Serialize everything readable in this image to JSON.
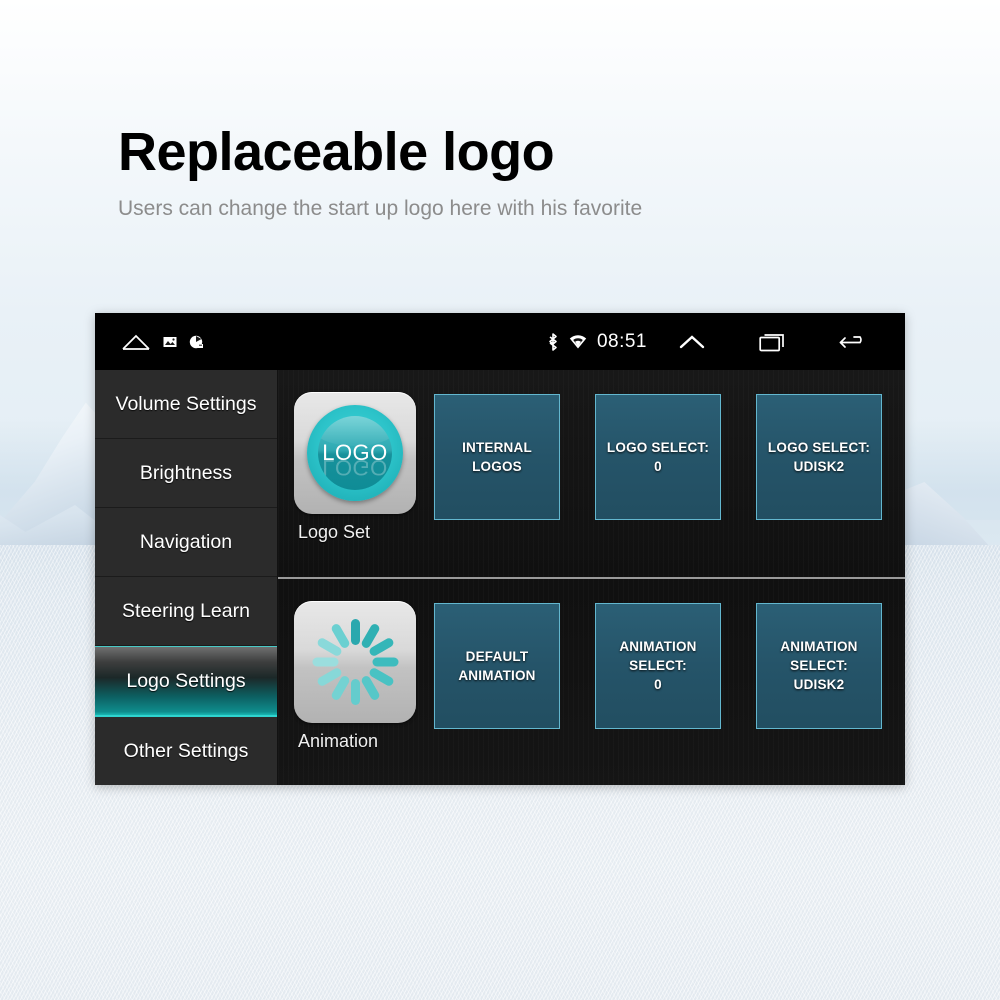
{
  "headline": {
    "title": "Replaceable logo",
    "subtitle": "Users can change the start up logo here with his favorite"
  },
  "colors": {
    "accent_teal": "#19b6b3",
    "tile_fill": "#255469",
    "tile_border": "#63b7cf",
    "logo_cyan": "#2cc3c9",
    "sidebar_bg": "#2b2b2b",
    "screen_bg": "#101010",
    "subtitle_gray": "#8c8c8c"
  },
  "statusbar": {
    "home_icon": "home-icon",
    "notif_image_icon": "image-notification-icon",
    "notif_app_icon": "app-notification-icon",
    "bluetooth_icon": "bluetooth-icon",
    "wifi_icon": "wifi-icon",
    "clock": "08:51",
    "expand_icon": "chevron-up-icon",
    "recents_icon": "recent-apps-icon",
    "back_icon": "back-arrow-icon"
  },
  "sidebar": {
    "items": [
      {
        "label": "Volume Settings",
        "selected": false
      },
      {
        "label": "Brightness",
        "selected": false
      },
      {
        "label": "Navigation",
        "selected": false
      },
      {
        "label": "Steering Learn",
        "selected": false
      },
      {
        "label": "Logo Settings",
        "selected": true
      },
      {
        "label": "Other Settings",
        "selected": false
      }
    ]
  },
  "content": {
    "rows": [
      {
        "icon_name": "logo-set-icon",
        "icon_glyph": "LOGO",
        "caption": "Logo Set",
        "tiles": [
          {
            "name": "internal-logos-tile",
            "label": "INTERNAL LOGOS"
          },
          {
            "name": "logo-select-0-tile",
            "label": "LOGO SELECT:\n0"
          },
          {
            "name": "logo-select-udisk2-tile",
            "label": "LOGO SELECT:\nUDISK2"
          }
        ]
      },
      {
        "icon_name": "animation-spinner-icon",
        "icon_glyph": "",
        "caption": "Animation",
        "tiles": [
          {
            "name": "default-animation-tile",
            "label": "DEFAULT\nANIMATION"
          },
          {
            "name": "animation-select-0-tile",
            "label": "ANIMATION\nSELECT:\n0"
          },
          {
            "name": "animation-select-udisk2-tile",
            "label": "ANIMATION\nSELECT:\nUDISK2"
          }
        ]
      }
    ]
  }
}
